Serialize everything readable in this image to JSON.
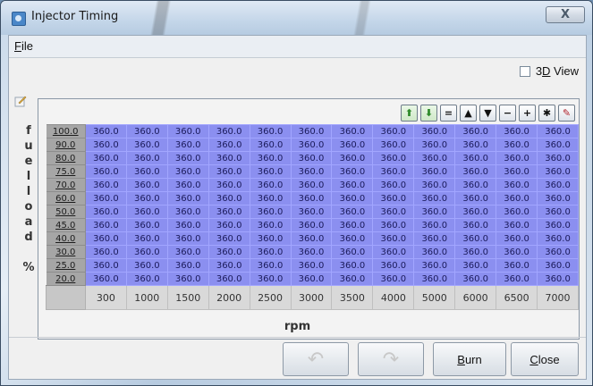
{
  "window": {
    "title": "Injector Timing",
    "close_label": "X"
  },
  "menu": {
    "file_prefix": "F",
    "file_rest": "ile"
  },
  "view3d": {
    "prefix": "3",
    "underlined": "D",
    "rest": " View",
    "checked": false
  },
  "yaxis": {
    "chars": [
      "f",
      "u",
      "e",
      "l",
      "l",
      "o",
      "a",
      "d",
      "",
      "%"
    ]
  },
  "toolbar": {
    "buttons": [
      {
        "icon": "arrow-up-green-icon",
        "glyph": "⬆"
      },
      {
        "icon": "arrow-down-green-icon",
        "glyph": "⬇"
      },
      {
        "icon": "equals-icon",
        "glyph": "="
      },
      {
        "icon": "triangle-up-icon",
        "glyph": "▲"
      },
      {
        "icon": "triangle-down-icon",
        "glyph": "▼"
      },
      {
        "icon": "minus-icon",
        "glyph": "−"
      },
      {
        "icon": "plus-icon",
        "glyph": "+"
      },
      {
        "icon": "multiply-icon",
        "glyph": "✱"
      },
      {
        "icon": "pencil-icon",
        "glyph": "✎"
      }
    ]
  },
  "table": {
    "row_labels": [
      "100.0",
      "90.0",
      "80.0",
      "75.0",
      "70.0",
      "60.0",
      "50.0",
      "45.0",
      "40.0",
      "30.0",
      "25.0",
      "20.0"
    ],
    "col_labels": [
      "300",
      "1000",
      "1500",
      "2000",
      "2500",
      "3000",
      "3500",
      "4000",
      "5000",
      "6000",
      "6500",
      "7000"
    ],
    "cell_value": "360.0"
  },
  "xaxis_label": "rpm",
  "footer": {
    "burn_prefix": "B",
    "burn_rest": "urn",
    "close_prefix": "C",
    "close_rest": "lose"
  },
  "colors": {
    "cell": "#8b8ff0",
    "label": "#a6a6a6"
  }
}
